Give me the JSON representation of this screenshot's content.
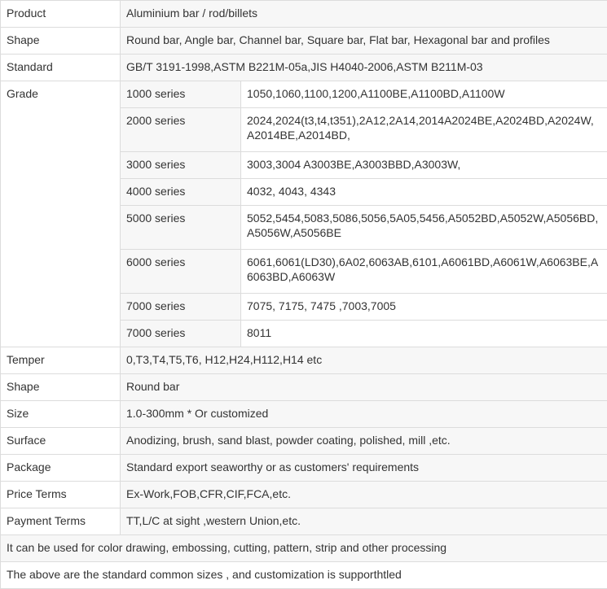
{
  "rows": {
    "product": {
      "key": "Product",
      "value": "Aluminium bar / rod/billets"
    },
    "shape1": {
      "key": "Shape",
      "value": "Round bar, Angle bar, Channel bar, Square bar, Flat bar, Hexagonal bar and profiles"
    },
    "standard": {
      "key": "Standard",
      "value": "GB/T 3191-1998,ASTM B221M-05a,JIS H4040-2006,ASTM B211M-03"
    },
    "grade": {
      "key": "Grade",
      "series": [
        {
          "name": "1000 series",
          "value": "1050,1060,1100,1200,A1100BE,A1100BD,A1100W"
        },
        {
          "name": "2000 series",
          "value": "2024,2024(t3,t4,t351),2A12,2A14,2014A2024BE,A2024BD,A2024W,A2014BE,A2014BD,"
        },
        {
          "name": "3000 series",
          "value": "3003,3004 A3003BE,A3003BBD,A3003W,"
        },
        {
          "name": "4000 series",
          "value": "4032, 4043, 4343"
        },
        {
          "name": "5000 series",
          "value": "5052,5454,5083,5086,5056,5A05,5456,A5052BD,A5052W,A5056BD,A5056W,A5056BE"
        },
        {
          "name": "6000 series",
          "value": "6061,6061(LD30),6A02,6063AB,6101,A6061BD,A6061W,A6063BE,A6063BD,A6063W"
        },
        {
          "name": "7000 series",
          "value": "7075, 7175, 7475 ,7003,7005"
        },
        {
          "name": "7000 series",
          "value": "8011"
        }
      ]
    },
    "temper": {
      "key": "Temper",
      "value": "0,T3,T4,T5,T6, H12,H24,H112,H14 etc"
    },
    "shape2": {
      "key": "Shape",
      "value": "Round bar"
    },
    "size": {
      "key": "Size",
      "value": "1.0-300mm * Or customized"
    },
    "surface": {
      "key": "Surface",
      "value": "Anodizing, brush, sand blast, powder coating, polished, mill ,etc."
    },
    "package": {
      "key": "Package",
      "value": "Standard export seaworthy or as customers' requirements"
    },
    "price_terms": {
      "key": "Price Terms",
      "value": "Ex-Work,FOB,CFR,CIF,FCA,etc."
    },
    "payment_terms": {
      "key": "Payment Terms",
      "value": "TT,L/C at sight ,western Union,etc."
    }
  },
  "notes": [
    "It can be used for color drawing, embossing, cutting, pattern, strip and other processing",
    "The above are the standard common sizes , and customization is supporthtled"
  ]
}
